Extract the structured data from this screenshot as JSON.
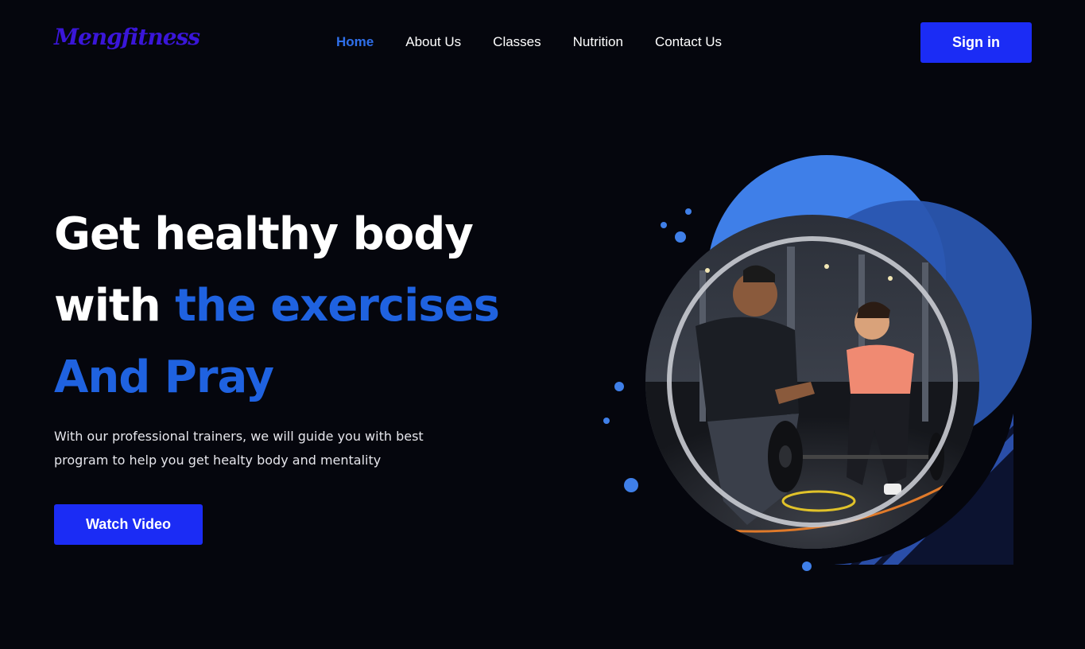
{
  "brand": {
    "logo_text": "Mengfitness"
  },
  "nav": {
    "items": [
      {
        "label": "Home",
        "active": true
      },
      {
        "label": "About Us",
        "active": false
      },
      {
        "label": "Classes",
        "active": false
      },
      {
        "label": "Nutrition",
        "active": false
      },
      {
        "label": "Contact Us",
        "active": false
      }
    ]
  },
  "header": {
    "signin_label": "Sign in"
  },
  "hero": {
    "headline_line1": "Get healthy body",
    "headline_line2_white": "with",
    "headline_line2_blue": "the exercises",
    "headline_line3": "And Pray",
    "subtext_line1": "With our professional trainers, we will guide you with best",
    "subtext_line2": "program to help you get healty body and mentality",
    "watch_label": "Watch Video"
  },
  "colors": {
    "background": "#05060d",
    "accent_blue": "#1f62e0",
    "button_blue": "#1b2cf5",
    "logo_purple": "#3a16d9",
    "circle_blue_light": "#3f7fe8",
    "circle_blue_dark": "#2a56b0"
  },
  "image": {
    "description_icon": "gym-trainer-photo"
  }
}
